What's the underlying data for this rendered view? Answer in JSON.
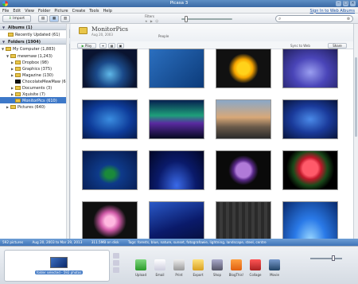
{
  "window": {
    "title": "Picasa 3"
  },
  "menu": {
    "items": [
      "File",
      "Edit",
      "View",
      "Folder",
      "Picture",
      "Create",
      "Tools",
      "Help"
    ],
    "sign_in": "Sign In to Web Albums"
  },
  "toolbar": {
    "import_label": "Import",
    "filters_label": "Filters"
  },
  "sidebar": {
    "albums_label": "Albums (1)",
    "recently_updated": "Recently Updated (61)",
    "folders_label": "Folders (1904)",
    "my_computer": "My Computer (1,883)",
    "items": [
      {
        "label": "mewmaw (1,243)",
        "icon": "folder-icon"
      },
      {
        "label": "Dropbox (98)",
        "icon": "folder-icon"
      },
      {
        "label": "Graphics (375)",
        "icon": "folder-icon"
      },
      {
        "label": "Magazine (130)",
        "icon": "folder-icon"
      },
      {
        "label": "ChocolateMewMaw (6)",
        "icon": "folder-icon"
      },
      {
        "label": "Documents (3)",
        "icon": "folder-icon"
      },
      {
        "label": "Xquisite (7)",
        "icon": "folder-icon"
      },
      {
        "label": "MonitorPics (610)",
        "icon": "folder-icon"
      },
      {
        "label": "Pictures (640)",
        "icon": "folder-icon"
      }
    ]
  },
  "folder": {
    "name": "MonitorPics",
    "date": "Aug 20, 2003",
    "people_label": "People",
    "play_label": "Play",
    "sync_label": "Sync to Web",
    "share_label": "Share"
  },
  "status": {
    "count": "592 pictures",
    "range": "Aug 20, 2003 to Mar 29, 2013",
    "size": "311.5MB on disk",
    "tags": "Tags: forests, blue, nature, sunset, fotografowie, lightning, landscape, steel, centre"
  },
  "tray": {
    "label": "folder selected - 592 photos",
    "actions": [
      "Upload",
      "Email",
      "Print",
      "Export",
      "Shop",
      "BlogThis!",
      "Collage",
      "Movie"
    ]
  },
  "colors": {
    "accent": "#3d78c8",
    "status_bar": "#4f86c6"
  }
}
